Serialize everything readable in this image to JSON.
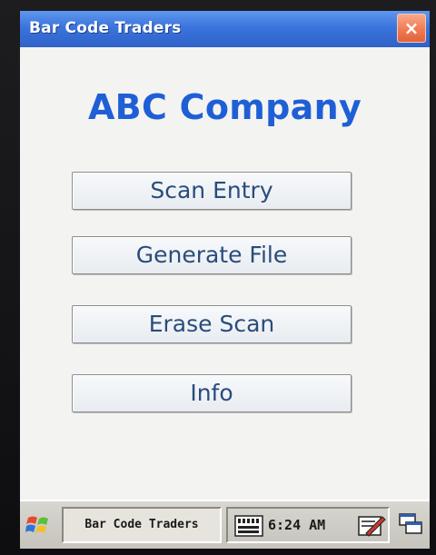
{
  "window": {
    "title": "Bar Code Traders",
    "close_label": "×"
  },
  "main": {
    "company_name": "ABC Company",
    "buttons": [
      {
        "label": "Scan Entry"
      },
      {
        "label": "Generate File"
      },
      {
        "label": "Erase Scan"
      },
      {
        "label": "Info"
      }
    ]
  },
  "taskbar": {
    "start_icon": "windows-flag-icon",
    "active_task": "Bar Code Traders",
    "keyboard_icon": "keyboard-icon",
    "clock": "6:24 AM",
    "input_icon": "input-panel-icon",
    "windows_icon": "window-switcher-icon"
  },
  "colors": {
    "titlebar": "#3a74dc",
    "company_text": "#1f5fd6",
    "close_button": "#f07b52",
    "screen_background": "#f3f3f1",
    "taskbar": "#c6c4bc"
  }
}
